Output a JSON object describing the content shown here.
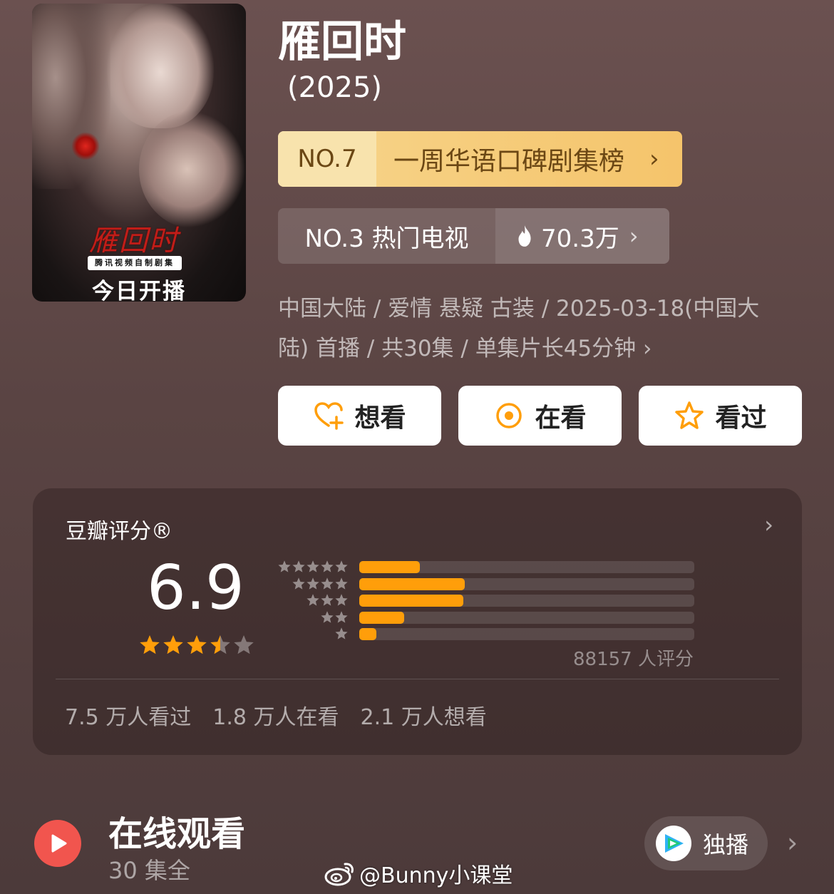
{
  "poster": {
    "logo_text": "雁回时",
    "sub_badge": "腾讯视频自制剧集",
    "premiere_text": "今日开播"
  },
  "title": "雁回时",
  "year": "(2025)",
  "rank_gold": {
    "number": "NO.7",
    "name": "一周华语口碑剧集榜"
  },
  "rank_gray": {
    "label": "NO.3 热门电视",
    "heat": "70.3万"
  },
  "meta": {
    "line1": "中国大陆 / 爱情 悬疑 古装 / 2025-03-18(中国大",
    "line2": "陆) 首播 / 共30集 / 单集片长45分钟"
  },
  "actions": [
    {
      "label": "想看",
      "icon": "heart-plus-icon"
    },
    {
      "label": "在看",
      "icon": "target-circle-icon"
    },
    {
      "label": "看过",
      "icon": "star-outline-icon"
    }
  ],
  "rating": {
    "title": "豆瓣评分®",
    "score": "6.9",
    "stars": 3.5,
    "distribution": [
      {
        "stars": 5,
        "fraction": 0.18
      },
      {
        "stars": 4,
        "fraction": 0.315
      },
      {
        "stars": 3,
        "fraction": 0.31
      },
      {
        "stars": 2,
        "fraction": 0.135
      },
      {
        "stars": 1,
        "fraction": 0.05
      }
    ],
    "count": "88157 人评分",
    "watched": "7.5 万人看过",
    "watching": "1.8 万人在看",
    "want": "2.1 万人想看"
  },
  "online": {
    "title": "在线观看",
    "episodes": "30 集全",
    "exclusive": "独播"
  },
  "watermark": "@Bunny小课堂",
  "colors": {
    "accent": "#ff9e0a",
    "gold": "#f5c46b",
    "play": "#f1554e"
  }
}
